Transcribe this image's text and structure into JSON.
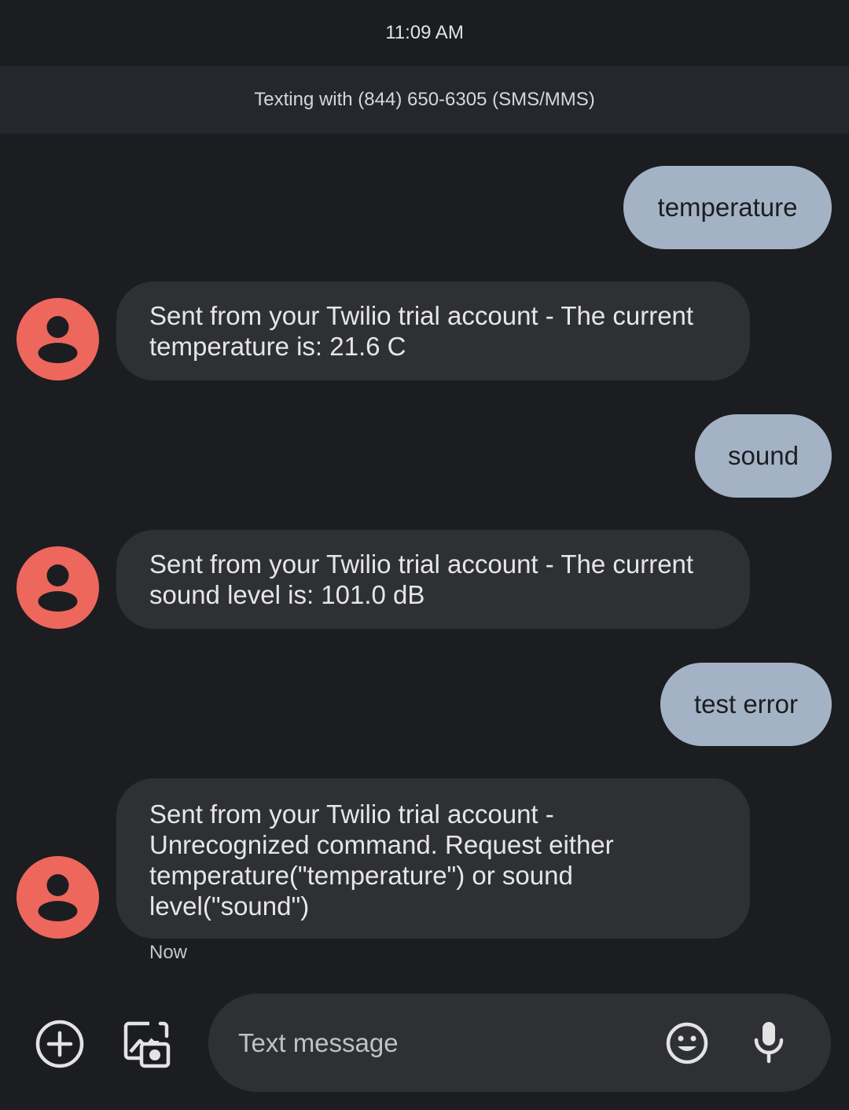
{
  "status_bar": {
    "time": "11:09 AM"
  },
  "conversation": {
    "banner": "Texting with (844) 650-6305 (SMS/MMS)"
  },
  "messages": [
    {
      "direction": "outgoing",
      "text": "temperature"
    },
    {
      "direction": "incoming",
      "text": "Sent from your Twilio trial account - The current temperature is: 21.6 C"
    },
    {
      "direction": "outgoing",
      "text": "sound"
    },
    {
      "direction": "incoming",
      "text": "Sent from your Twilio trial account - The current sound level is: 101.0 dB"
    },
    {
      "direction": "outgoing",
      "text": "test error"
    },
    {
      "direction": "incoming",
      "text": "Sent from your Twilio trial account - Unrecognized command. Request either temperature(\"temperature\") or sound level(\"sound\")",
      "timestamp": "Now"
    }
  ],
  "compose": {
    "placeholder": "Text message",
    "icons": [
      "add-circle-icon",
      "gallery-camera-icon",
      "emoji-icon",
      "microphone-icon"
    ]
  },
  "colors": {
    "background": "#1c1d21",
    "banner": "#24272d",
    "outgoing_bubble": "#a3b3c5",
    "incoming_bubble": "#2e3034",
    "avatar": "#ee675c"
  }
}
